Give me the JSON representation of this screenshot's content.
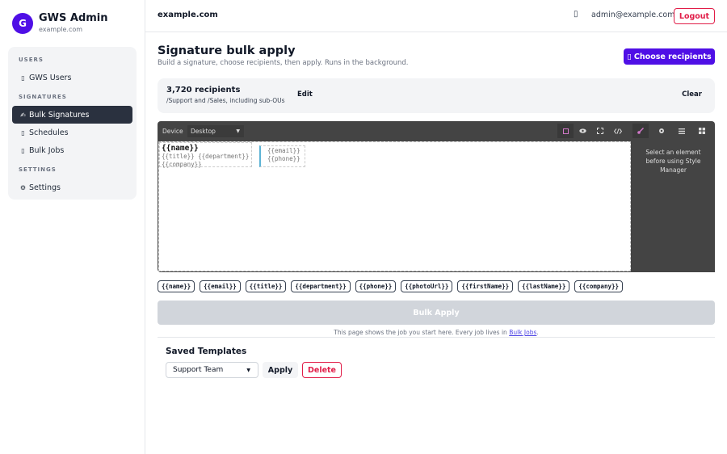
{
  "brand": {
    "initial": "G",
    "title": "GWS Admin",
    "subtitle": "example.com"
  },
  "sidebar": {
    "sections": [
      {
        "label": "USERS",
        "items": [
          {
            "icon": "▯",
            "label": "GWS Users"
          }
        ]
      },
      {
        "label": "SIGNATURES",
        "items": [
          {
            "icon": "✍",
            "label": "Bulk Signatures",
            "active": true
          },
          {
            "icon": "▯",
            "label": "Schedules"
          },
          {
            "icon": "▯",
            "label": "Bulk Jobs"
          }
        ]
      },
      {
        "label": "SETTINGS",
        "items": [
          {
            "icon": "⚙",
            "label": "Settings"
          }
        ]
      }
    ]
  },
  "topbar": {
    "domain": "example.com",
    "bell_icon": "▯",
    "user_email": "admin@example.com",
    "logout_label": "Logout"
  },
  "page": {
    "title": "Signature bulk apply",
    "subtitle": "Build a signature, choose recipients, then apply. Runs in the background.",
    "choose_label": "▯ Choose recipients"
  },
  "recipients": {
    "count": "3,720 recipients",
    "scope": "/Support and /Sales, including sub-OUs",
    "edit_label": "Edit",
    "clear_label": "Clear"
  },
  "editor": {
    "device_label": "Device",
    "device_value": "Desktop",
    "style_message": "Select an element before using Style Manager",
    "signature": {
      "name": "{{name}}",
      "title_dept": "{{title}}  {{department}}",
      "company": "{{company}}",
      "email": "{{email}}",
      "phone": "{{phone}}"
    }
  },
  "placeholders": [
    "{{name}}",
    "{{email}}",
    "{{title}}",
    "{{department}}",
    "{{phone}}",
    "{{photoUrl}}",
    "{{firstName}}",
    "{{lastName}}",
    "{{company}}"
  ],
  "bulk_apply_label": "Bulk Apply",
  "note": {
    "text": "This page shows the job you start here. Every job lives in ",
    "link": "Bulk Jobs",
    "suffix": "."
  },
  "saved_templates": {
    "title": "Saved Templates",
    "selected": "Support Team",
    "apply_label": "Apply",
    "delete_label": "Delete"
  }
}
